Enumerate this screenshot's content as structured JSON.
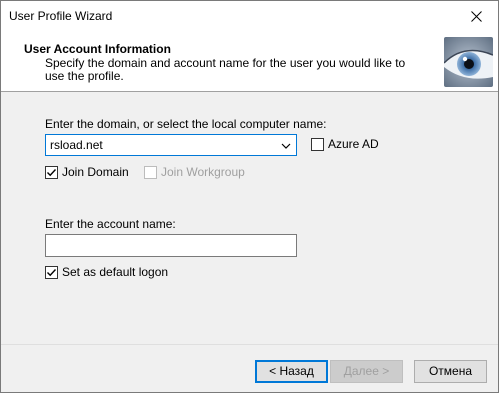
{
  "window": {
    "title": "User Profile Wizard"
  },
  "header": {
    "title": "User Account  Information",
    "description": "Specify the domain and account name for the user you would like to use the profile."
  },
  "domain": {
    "label": "Enter the domain, or select the local computer name:",
    "value": "rsload.net",
    "azure_label": "Azure AD",
    "azure_checked": false,
    "join_domain_label": "Join Domain",
    "join_domain_checked": true,
    "join_workgroup_label": "Join Workgroup",
    "join_workgroup_checked": false
  },
  "account": {
    "label": "Enter the account name:",
    "value": "",
    "default_logon_label": "Set as default logon",
    "default_logon_checked": true
  },
  "buttons": {
    "back": "< Назад",
    "next": "Далее >",
    "cancel": "Отмена"
  },
  "icons": {
    "close": "close-icon",
    "combo_arrow": "chevron-down-icon",
    "check": "checkmark-icon",
    "header_image": "eye-icon"
  }
}
